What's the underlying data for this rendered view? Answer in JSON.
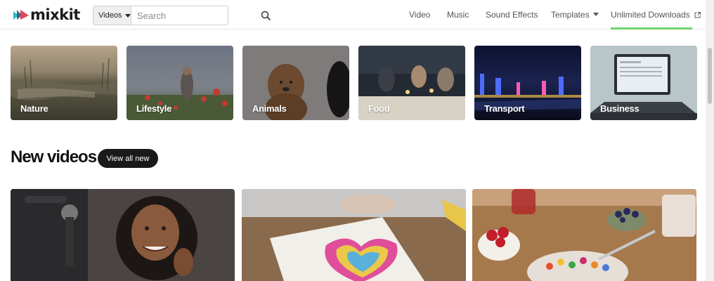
{
  "header": {
    "logo_text": "mixkit",
    "search": {
      "category": "Videos",
      "placeholder": "Search"
    },
    "nav": [
      {
        "label": "Video"
      },
      {
        "label": "Music"
      },
      {
        "label": "Sound Effects"
      },
      {
        "label": "Templates"
      },
      {
        "label": "Unlimited Downloads"
      }
    ]
  },
  "categories": [
    {
      "label": "Nature"
    },
    {
      "label": "Lifestyle"
    },
    {
      "label": "Animals"
    },
    {
      "label": "Food"
    },
    {
      "label": "Transport"
    },
    {
      "label": "Business"
    }
  ],
  "new_videos": {
    "title": "New videos",
    "view_all": "View all new"
  },
  "colors": {
    "active_tab_underline": "#6fd36c",
    "button_dark": "#1a1a1a",
    "logo_red": "#e8445a",
    "logo_teal": "#2fb8c6"
  }
}
